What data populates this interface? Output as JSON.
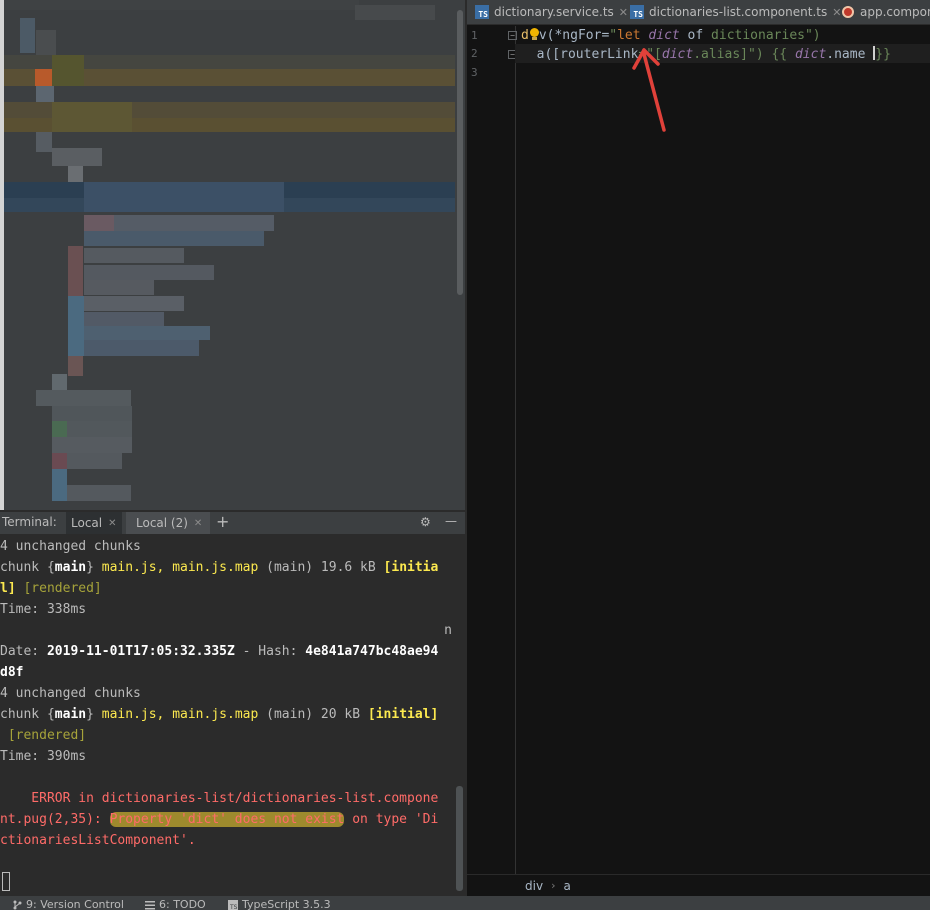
{
  "editor": {
    "tabs": [
      {
        "label": "dictionary.service.ts",
        "icon": "typescript-file-icon",
        "closable": true
      },
      {
        "label": "dictionaries-list.component.ts",
        "icon": "typescript-file-icon",
        "closable": true
      },
      {
        "label": "app.compone",
        "icon": "angular-component-icon",
        "closable": false
      }
    ],
    "line_numbers": [
      "1",
      "2",
      "3"
    ],
    "code_line1": {
      "part1": "d",
      "part2": "v(*ngFor=",
      "quote": "\"",
      "kw": "let",
      "sp": " ",
      "var": "dict",
      "of": " of ",
      "coll": "dictionaries",
      "close": "\")"
    },
    "code_line2": {
      "indent": "  ",
      "part1": "a([routerLink",
      "part2": "=\"[",
      "var1": "dict",
      "part3": ".alias]\") ",
      "open": "{{ ",
      "var2": "dict",
      "part4": ".name ",
      "close": "}}"
    },
    "breadcrumb": [
      "div",
      "a"
    ],
    "annotation_arrow_color": "#e0413a"
  },
  "terminal": {
    "header": {
      "title": "Terminal:",
      "tabs": [
        {
          "label": "Local"
        },
        {
          "label": "Local (2)"
        }
      ],
      "add_label": "+"
    },
    "lines": {
      "l1": "4 unchanged chunks",
      "l2_a": "chunk {",
      "l2_b": "main",
      "l2_c": "} ",
      "l2_d": "main.js, main.js.map",
      "l2_e": " (main) 19.6 kB ",
      "l2_f": "[initia",
      "l3_a": "l]",
      "l3_b": " [rendered]",
      "l4": "Time: 338ms",
      "l5": "n",
      "l6_a": "Date: ",
      "l6_b": "2019-11-01T17:05:32.335Z",
      "l6_c": " - Hash: ",
      "l6_d": "4e841a747bc48ae94",
      "l7": "d8f",
      "l8": "4 unchanged chunks",
      "l9_a": "chunk {",
      "l9_b": "main",
      "l9_c": "} ",
      "l9_d": "main.js, main.js.map",
      "l9_e": " (main) 20 kB ",
      "l9_f": "[initial]",
      "l10": " [rendered]",
      "l11": "Time: 390ms",
      "l12": "",
      "l13": "    ERROR in dictionaries-list/dictionaries-list.compone",
      "l14_a": "nt.pug(2,35): ",
      "l14_b": "Property 'dict' does not exist",
      "l14_c": " on type 'Di",
      "l15": "ctionariesListComponent'."
    }
  },
  "statusbar": {
    "items": [
      {
        "label": "9: Version Control",
        "icon": "branch-icon"
      },
      {
        "label": "6: TODO",
        "icon": "list-icon"
      },
      {
        "label": "TypeScript 3.5.3",
        "icon": "typescript-icon"
      }
    ]
  }
}
